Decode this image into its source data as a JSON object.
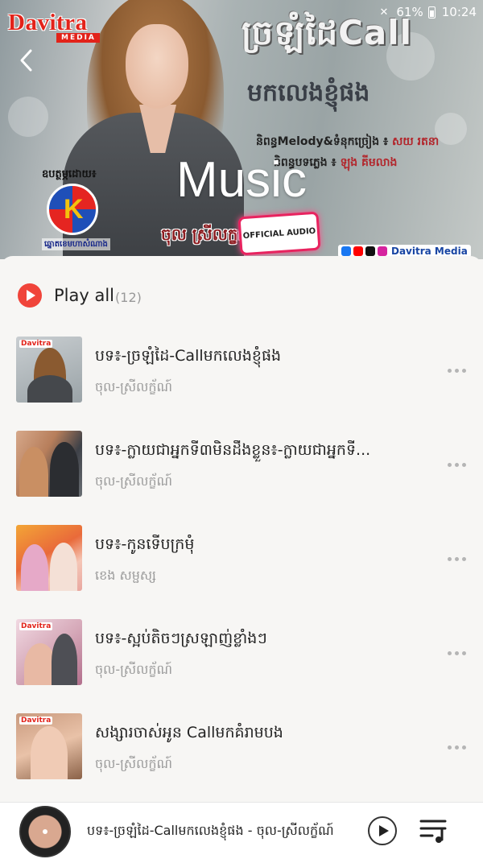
{
  "status_bar": {
    "battery": "61%",
    "time": "10:24"
  },
  "header": {
    "brand_name": "Davitra",
    "brand_sub": "MEDIA",
    "album_title_kh": "ច្រឡំដៃCall",
    "album_sub_kh": "មកលេងខ្ញុំផង",
    "credit_melody_label": "និពន្ធMelody&ទំនុកច្រៀង ៖",
    "credit_melody_value": "សយ រតនា",
    "credit_lyrics_label": "និពន្ធបទភ្លេង ៖",
    "credit_lyrics_value": "ឡុង គីមលាង",
    "sponsor_label": "ឧបត្ថម្ភដោយ៖",
    "sponsor_name": "ឆ្នោតខេមហាសំណាង",
    "singer_tag": "ចុល ស្រីលក្ខណ៍",
    "official_badge": "OFFICIAL AUDIO",
    "social_handle": "Davitra Media",
    "page_title": "Music"
  },
  "playlist": {
    "play_all_label": "Play all",
    "count": "(12)",
    "songs": [
      {
        "title": "បទ៖-ច្រឡំដៃ-Callមកលេងខ្ញុំផង",
        "artist": "ចុល-ស្រីលក្ខ័ណ៍"
      },
      {
        "title": "បទ៖-ក្លាយជាអ្នកទី៣មិនដឹងខ្លួន៖-ក្លាយជាអ្នកទី...",
        "artist": "ចុល-ស្រីលក្ខ័ណ៍"
      },
      {
        "title": "បទ៖-កូនទើបក្រមុំ",
        "artist": "ខេង សម្ផស្ស"
      },
      {
        "title": "បទ៖-ស្អប់តិចៗស្រឡាញ់ខ្លាំងៗ",
        "artist": "ចុល-ស្រីលក្ខ័ណ៍"
      },
      {
        "title": "សង្សារចាស់អូន Callមកគំរាមបង",
        "artist": "ចុល-ស្រីលក្ខ័ណ៍"
      }
    ]
  },
  "player": {
    "now_playing": "បទ៖-ច្រឡំដៃ-Callមកលេងខ្ញុំផង - ចុល-ស្រីលក្ខ័ណ៍"
  },
  "colors": {
    "accent_red": "#f0443a",
    "brand_red": "#e2231a",
    "background": "#f7f6f4"
  }
}
